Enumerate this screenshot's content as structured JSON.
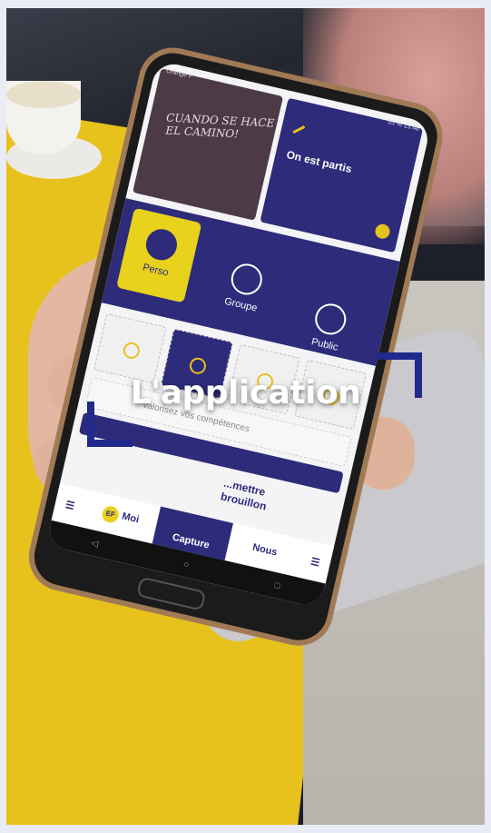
{
  "overlay": {
    "title": "L'application"
  },
  "phone_screen": {
    "photo_card_text": "CUANDO SE HACE EL CAMINO!",
    "highlight_card_label": "On est partis",
    "visibility_options": [
      "Perso",
      "Groupe",
      "Public"
    ],
    "skills_prompt": "Valorisez vos compétences",
    "draft_label_line1": "...mettre",
    "draft_label_line2": "brouillon",
    "nav": {
      "moi_badge": "EF",
      "moi": "Moi",
      "capture": "Capture",
      "nous": "Nous"
    },
    "status_left": "Orange F",
    "status_right": "53 % 13:48"
  },
  "colors": {
    "brand_navy": "#2d2b7a",
    "brand_yellow": "#e8d21c",
    "bracket_blue": "#1f2a8c"
  }
}
